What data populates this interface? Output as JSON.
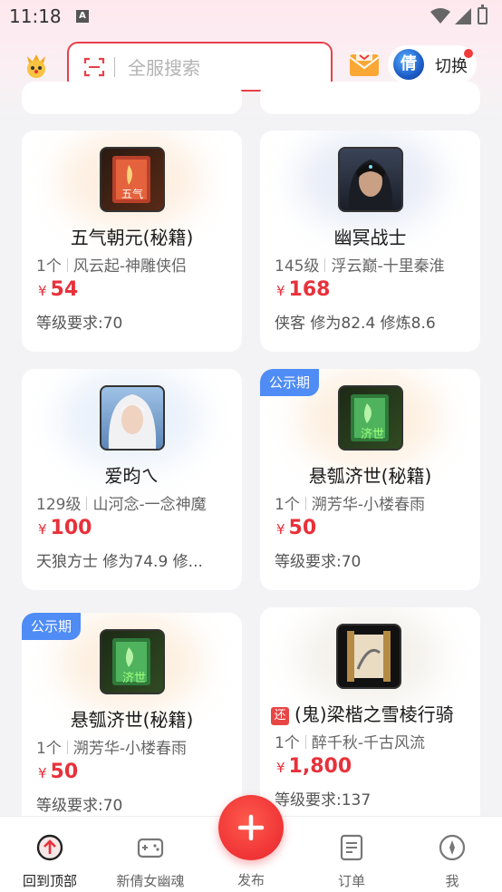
{
  "status_bar": {
    "time": "11:18",
    "notification_letter": "A"
  },
  "header": {
    "search_placeholder": "全服搜索",
    "switch_label": "切换",
    "game_avatar_char": "倩"
  },
  "listings": [
    {
      "title": "五气朝元(秘籍)",
      "level": "1个",
      "server": "风云起-神雕侠侣",
      "currency": "¥",
      "price": "54",
      "note": "等级要求:70",
      "thumb_char": "五气",
      "thumb_style": "book-red"
    },
    {
      "title": "幽冥战士",
      "level": "145级",
      "server": "浮云巅-十里秦淮",
      "currency": "¥",
      "price": "168",
      "note": "侠客 修为82.4 修炼8.6",
      "thumb_style": "portrait-dark"
    },
    {
      "title": "爱昀ㄟ",
      "level": "129级",
      "server": "山河念-一念神魔",
      "currency": "¥",
      "price": "100",
      "note": "天狼方士 修为74.9 修...",
      "thumb_style": "portrait-white"
    },
    {
      "badge": "公示期",
      "title": "悬瓠济世(秘籍)",
      "level": "1个",
      "server": "溯芳华-小楼春雨",
      "currency": "¥",
      "price": "50",
      "note": "等级要求:70",
      "thumb_char": "济世",
      "thumb_style": "book-green"
    },
    {
      "badge": "公示期",
      "title": "悬瓠济世(秘籍)",
      "level": "1个",
      "server": "溯芳华-小楼春雨",
      "currency": "¥",
      "price": "50",
      "note": "等级要求:70",
      "thumb_char": "济世",
      "thumb_style": "book-green"
    },
    {
      "return_tag": "还",
      "title": "(鬼)梁楷之雪棱行骑",
      "level": "1个",
      "server": "醉千秋-千古风流",
      "currency": "¥",
      "price": "1,800",
      "note": "等级要求:137",
      "thumb_style": "scroll"
    }
  ],
  "bottom_nav": {
    "back_to_top": "回到顶部",
    "game": "新倩女幽魂",
    "publish": "发布",
    "orders": "订单",
    "me": "我"
  },
  "colors": {
    "accent": "#e8313b",
    "badge": "#4f8cf5"
  }
}
